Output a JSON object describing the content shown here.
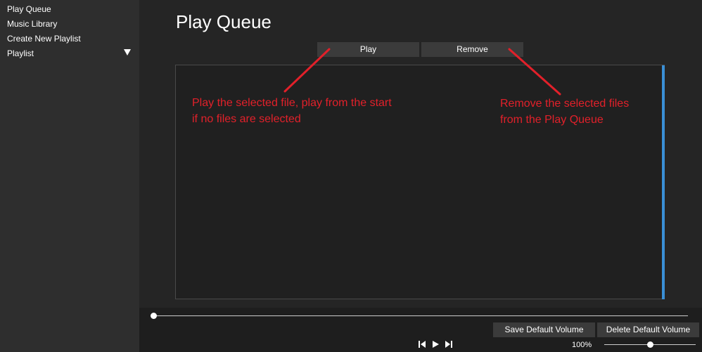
{
  "sidebar": {
    "items": [
      {
        "label": "Play Queue"
      },
      {
        "label": "Music Library"
      },
      {
        "label": "Create New Playlist"
      },
      {
        "label": "Playlist"
      }
    ],
    "expand_icon": "triangle-down-icon"
  },
  "main": {
    "title": "Play Queue",
    "buttons": {
      "play_label": "Play",
      "remove_label": "Remove"
    },
    "queue_items": []
  },
  "annotations": {
    "play": [
      "Play the selected file, play from the start",
      "if no files are selected"
    ],
    "remove": [
      "Remove the selected files",
      "from the Play Queue"
    ],
    "color": "#e2202a"
  },
  "bottom": {
    "save_volume_label": "Save Default Volume",
    "delete_volume_label": "Delete Default Volume",
    "volume_text": "100%",
    "volume_level": 0.5,
    "seek_progress": 0.0,
    "transport_icons": [
      "skip-previous-icon",
      "play-icon",
      "skip-next-icon"
    ]
  },
  "colors": {
    "background": "#252525",
    "sidebar": "#2e2e2e",
    "button": "#3b3b3b",
    "scrollbar_accent": "#3a8fd6",
    "annotation": "#e2202a"
  }
}
